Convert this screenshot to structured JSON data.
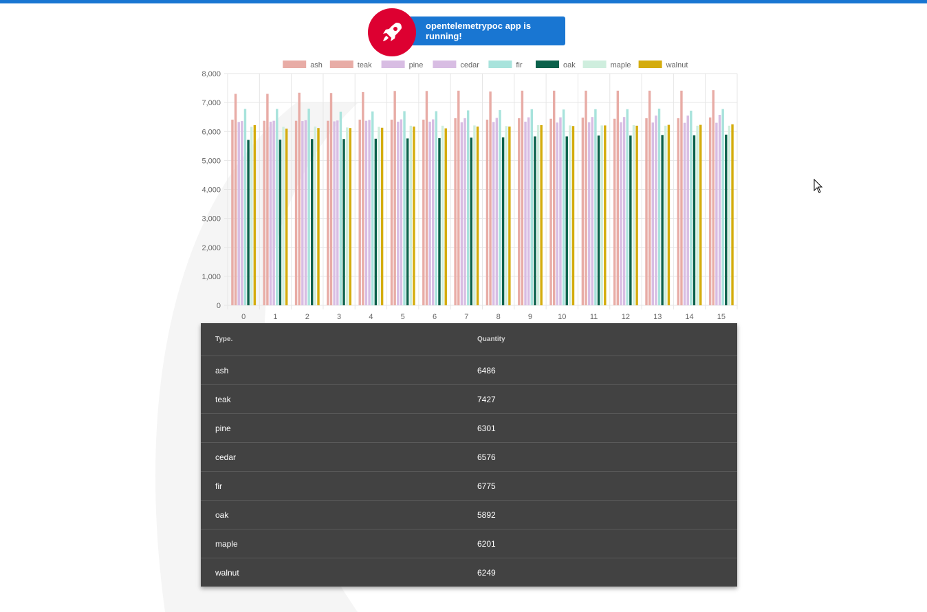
{
  "banner": {
    "message": "opentelemetrypoc app is running!",
    "icon": "rocket-icon",
    "colors": {
      "rocket_bg": "#dd0031",
      "pill_bg": "#1976d2",
      "top_bar": "#1976d2"
    }
  },
  "chart_data": {
    "type": "bar",
    "categories": [
      "0",
      "1",
      "2",
      "3",
      "4",
      "5",
      "6",
      "7",
      "8",
      "9",
      "10",
      "11",
      "12",
      "13",
      "14",
      "15"
    ],
    "ylim": [
      0,
      8000
    ],
    "yticks": [
      0,
      1000,
      2000,
      3000,
      4000,
      5000,
      6000,
      7000,
      8000
    ],
    "ytick_labels": [
      "0",
      "1,000",
      "2,000",
      "3,000",
      "4,000",
      "5,000",
      "6,000",
      "7,000",
      "8,000"
    ],
    "legend_position": "top",
    "grid": true,
    "series": [
      {
        "name": "ash",
        "color": "#e8aca6",
        "values": [
          6410,
          6370,
          6370,
          6370,
          6410,
          6410,
          6410,
          6460,
          6410,
          6460,
          6440,
          6480,
          6440,
          6460,
          6460,
          6486
        ]
      },
      {
        "name": "teak",
        "color": "#e8aca6",
        "values": [
          7300,
          7300,
          7340,
          7330,
          7360,
          7400,
          7400,
          7410,
          7380,
          7410,
          7410,
          7410,
          7410,
          7410,
          7410,
          7427
        ]
      },
      {
        "name": "pine",
        "color": "#d8bde3",
        "values": [
          6330,
          6340,
          6360,
          6350,
          6370,
          6340,
          6340,
          6320,
          6330,
          6340,
          6310,
          6320,
          6320,
          6310,
          6300,
          6301
        ]
      },
      {
        "name": "cedar",
        "color": "#d8bde3",
        "values": [
          6360,
          6370,
          6390,
          6380,
          6400,
          6420,
          6420,
          6460,
          6470,
          6490,
          6490,
          6500,
          6500,
          6550,
          6550,
          6576
        ]
      },
      {
        "name": "fir",
        "color": "#a8e3dc",
        "values": [
          6780,
          6780,
          6790,
          6680,
          6690,
          6700,
          6700,
          6730,
          6740,
          6770,
          6760,
          6770,
          6770,
          6790,
          6720,
          6775
        ]
      },
      {
        "name": "oak",
        "color": "#0b614b",
        "values": [
          5710,
          5720,
          5740,
          5740,
          5750,
          5760,
          5770,
          5790,
          5800,
          5830,
          5830,
          5860,
          5860,
          5880,
          5870,
          5892
        ]
      },
      {
        "name": "maple",
        "color": "#cfeede",
        "values": [
          6160,
          6160,
          6170,
          6140,
          6160,
          6200,
          6200,
          6210,
          6190,
          6220,
          6210,
          6210,
          6220,
          6200,
          6200,
          6201
        ]
      },
      {
        "name": "walnut",
        "color": "#d4ac0d",
        "values": [
          6220,
          6100,
          6120,
          6120,
          6130,
          6170,
          6110,
          6170,
          6170,
          6220,
          6190,
          6210,
          6200,
          6230,
          6230,
          6249
        ]
      }
    ]
  },
  "table": {
    "headers": {
      "type": "Type.",
      "quantity": "Quantity"
    },
    "rows": [
      {
        "type": "ash",
        "quantity": "6486"
      },
      {
        "type": "teak",
        "quantity": "7427"
      },
      {
        "type": "pine",
        "quantity": "6301"
      },
      {
        "type": "cedar",
        "quantity": "6576"
      },
      {
        "type": "fir",
        "quantity": "6775"
      },
      {
        "type": "oak",
        "quantity": "5892"
      },
      {
        "type": "maple",
        "quantity": "6201"
      },
      {
        "type": "walnut",
        "quantity": "6249"
      }
    ]
  }
}
